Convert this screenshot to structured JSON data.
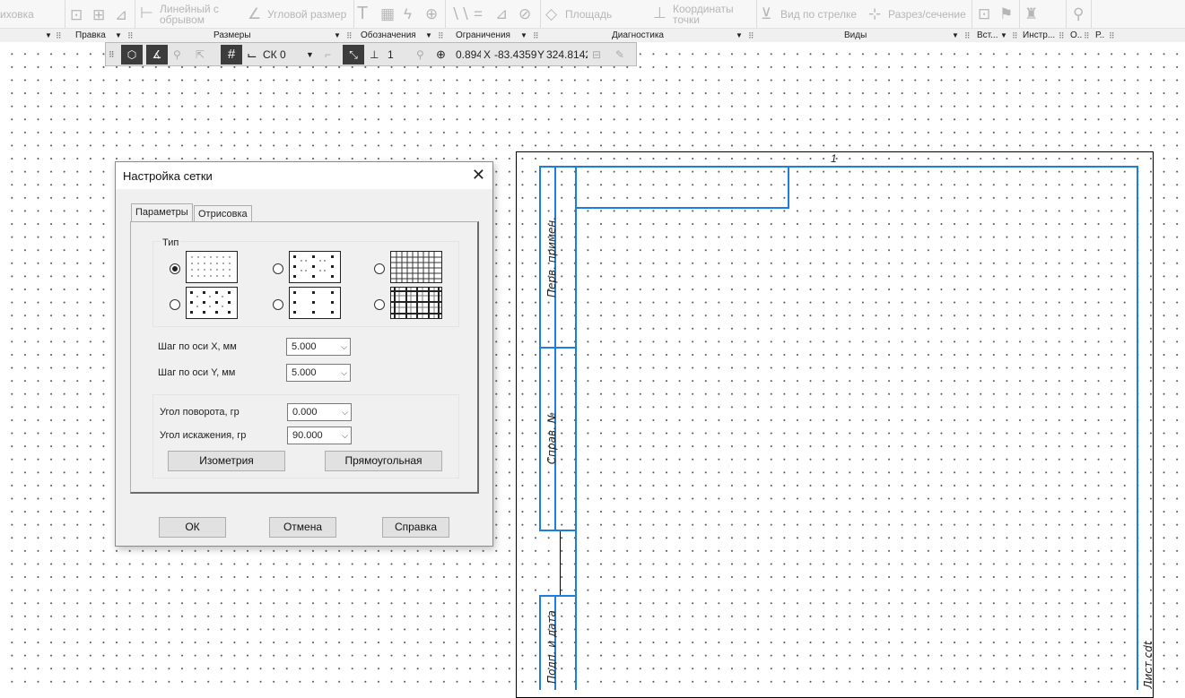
{
  "ribbon": {
    "items": {
      "hatch": "иховка",
      "linear_break_1": "Линейный с",
      "linear_break_2": "обрывом",
      "angular": "Угловой размер",
      "area": "Площадь",
      "coords_1": "Координаты",
      "coords_2": "точки",
      "arrow_view": "Вид по стрелке",
      "section": "Разрез/сечение"
    },
    "groups": {
      "edit": "Правка",
      "dims": "Размеры",
      "marks": "Обозначения",
      "constraints": "Ограничения",
      "diagnostics": "Диагностика",
      "views": "Виды",
      "insert": "Вст...",
      "tools": "Инстр...",
      "o": "О..",
      "r": "Р.."
    }
  },
  "toolbar": {
    "cs": "СК 0",
    "layer_num": "1",
    "zoom": "0.894",
    "x_label": "X",
    "x_value": "-83.4359",
    "y_label": "Y",
    "y_value": "324.8142"
  },
  "sheet": {
    "top_num": "1",
    "label_perv": "Перв. примен.",
    "label_sprav": "Справ. №",
    "label_podp": "Подп. и дата",
    "label_right": "Лист.cdt"
  },
  "dialog": {
    "title": "Настройка сетки",
    "tabs": [
      "Параметры",
      "Отрисовка"
    ],
    "type_group": "Тип",
    "selected_type": 0,
    "step_x_label": "Шаг по оси  X, мм",
    "step_x_value": "5.000",
    "step_y_label": "Шаг по оси  Y, мм",
    "step_y_value": "5.000",
    "rotation_label": "Угол поворота, гр",
    "rotation_value": "0.000",
    "skew_label": "Угол искажения, гр",
    "skew_value": "90.000",
    "isometry_btn": "Изометрия",
    "rect_btn": "Прямоугольная",
    "ok": "ОК",
    "cancel": "Отмена",
    "help": "Справка"
  }
}
